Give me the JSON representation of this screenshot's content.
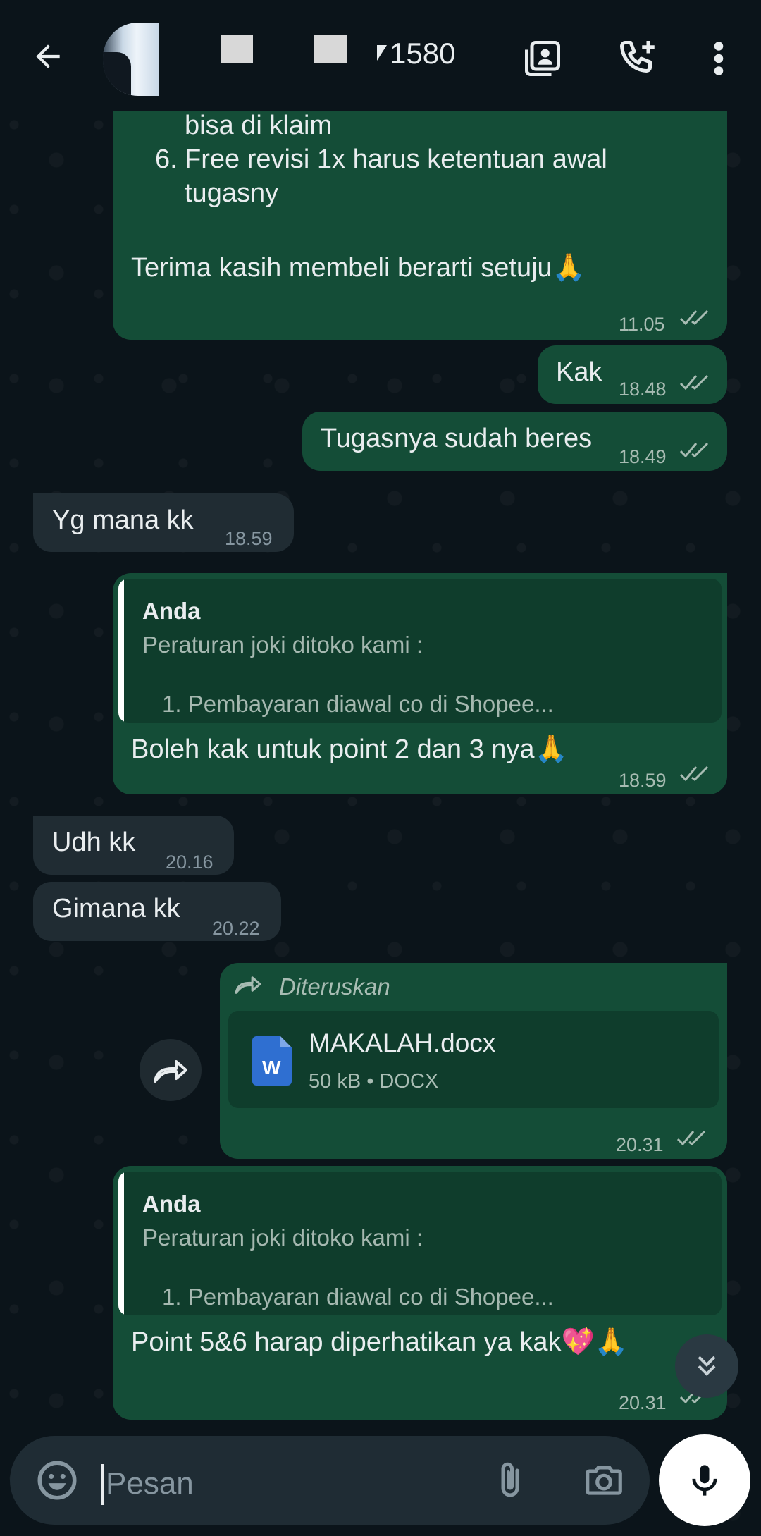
{
  "header": {
    "title": "1580",
    "back_icon": "arrow-left-icon",
    "icons": [
      "contact-card-icon",
      "add-call-icon",
      "more-vert-icon"
    ]
  },
  "messages": {
    "m1": {
      "line_a": "bisa di klaim",
      "item6_number": "6.",
      "item6_line1": "Free revisi 1x harus ketentuan awal",
      "item6_line2": "tugasny",
      "closing": "Terima kasih membeli berarti setuju🙏",
      "time": "11.05"
    },
    "m2": {
      "text": "Kak",
      "time": "18.48"
    },
    "m3": {
      "text": "Tugasnya sudah beres",
      "time": "18.49"
    },
    "m4": {
      "text": "Yg mana kk",
      "time": "18.59"
    },
    "m5": {
      "quote_author": "Anda",
      "quote_line1": "Peraturan joki ditoko kami :",
      "quote_line2": "1. Pembayaran diawal co di Shopee...",
      "text": "Boleh kak untuk point 2 dan 3 nya🙏",
      "time": "18.59"
    },
    "m6": {
      "text": "Udh kk",
      "time": "20.16"
    },
    "m7": {
      "text": "Gimana kk",
      "time": "20.22"
    },
    "m8": {
      "forwarded_label": "Diteruskan",
      "file_name": "MAKALAH.docx",
      "file_meta": "50 kB • DOCX",
      "file_icon_letter": "W",
      "time": "20.31"
    },
    "m9": {
      "quote_author": "Anda",
      "quote_line1": "Peraturan joki ditoko kami :",
      "quote_line2": "1. Pembayaran diawal co di Shopee...",
      "text": "Point 5&6 harap diperhatikan ya kak💖🙏",
      "time": "20.31"
    }
  },
  "composer": {
    "placeholder": "Pesan",
    "icons": [
      "emoji-icon",
      "attach-icon",
      "camera-icon",
      "mic-icon"
    ]
  },
  "colors": {
    "outgoing_bubble": "#144d37",
    "incoming_bubble": "#202c33",
    "background": "#0b141a",
    "tick_read": "#a8bcb3"
  }
}
